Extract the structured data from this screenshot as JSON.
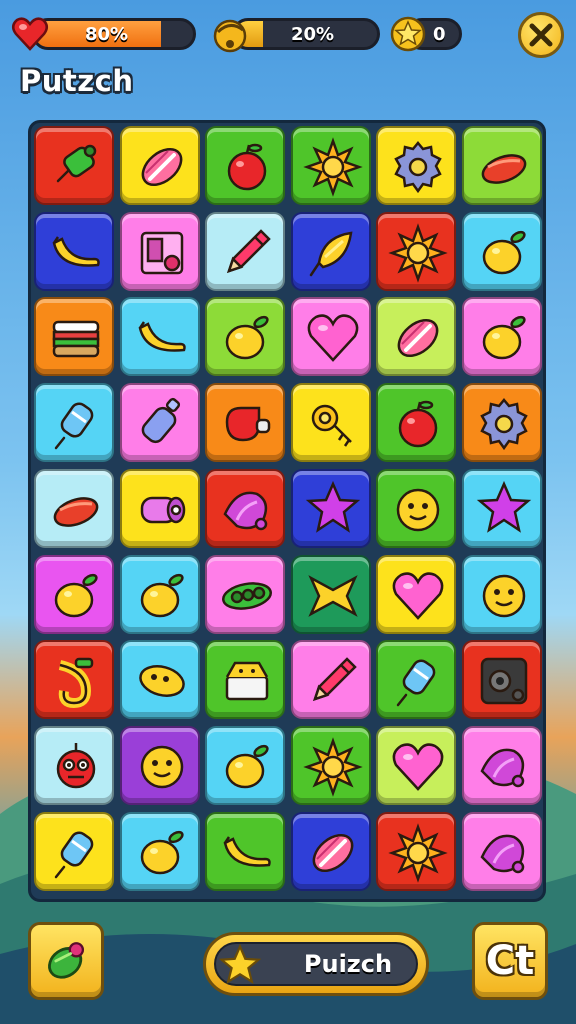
{
  "hud": {
    "health": {
      "label": "80%",
      "value": 0.8,
      "icon": "heart-icon"
    },
    "energy": {
      "label": "20%",
      "value": 0.2,
      "icon": "bomb-icon"
    },
    "coins": {
      "label": "0",
      "icon": "star-coin-icon"
    },
    "close": {
      "icon": "close-icon"
    }
  },
  "title": "Putzch",
  "colors": {
    "red": "#e8321f",
    "yellow": "#fde21c",
    "green": "#4fc52a",
    "darkgreen": "#1e9a5a",
    "blue": "#2f3fd8",
    "magenta": "#e955f0",
    "cyan": "#55d4f5",
    "lightblue": "#b6ecf6",
    "orange": "#f88a18",
    "pink": "#ff7ee8",
    "purple": "#9a3fd8",
    "lightgreen": "#c7ef5b",
    "lime": "#8ddb38"
  },
  "board": {
    "rows": [
      [
        {
          "color": "red",
          "icon": "green-candy-icon"
        },
        {
          "color": "yellow",
          "icon": "pink-candy-icon"
        },
        {
          "color": "green",
          "icon": "apple-icon"
        },
        {
          "color": "green",
          "icon": "sun-icon"
        },
        {
          "color": "yellow",
          "icon": "gear-icon"
        },
        {
          "color": "lime",
          "icon": "sausage-icon"
        }
      ],
      [
        {
          "color": "blue",
          "icon": "banana-icon"
        },
        {
          "color": "pink",
          "icon": "box-icon"
        },
        {
          "color": "lightblue",
          "icon": "pencil-icon"
        },
        {
          "color": "blue",
          "icon": "cone-icon"
        },
        {
          "color": "red",
          "icon": "sun-icon"
        },
        {
          "color": "cyan",
          "icon": "lemon-icon"
        }
      ],
      [
        {
          "color": "orange",
          "icon": "sandwich-icon"
        },
        {
          "color": "cyan",
          "icon": "banana-icon"
        },
        {
          "color": "lime",
          "icon": "lemon-icon"
        },
        {
          "color": "pink",
          "icon": "heart-icon"
        },
        {
          "color": "lightgreen",
          "icon": "pink-candy-icon"
        },
        {
          "color": "pink",
          "icon": "lemon-icon"
        }
      ],
      [
        {
          "color": "cyan",
          "icon": "candy-icon"
        },
        {
          "color": "pink",
          "icon": "bottle-icon"
        },
        {
          "color": "orange",
          "icon": "whistle-icon"
        },
        {
          "color": "yellow",
          "icon": "key-icon"
        },
        {
          "color": "green",
          "icon": "apple-icon"
        },
        {
          "color": "orange",
          "icon": "gear-icon"
        }
      ],
      [
        {
          "color": "lightblue",
          "icon": "sausage-icon"
        },
        {
          "color": "yellow",
          "icon": "roll-icon"
        },
        {
          "color": "red",
          "icon": "shell-icon"
        },
        {
          "color": "blue",
          "icon": "star-icon"
        },
        {
          "color": "green",
          "icon": "face-icon"
        },
        {
          "color": "cyan",
          "icon": "star-icon"
        }
      ],
      [
        {
          "color": "magenta",
          "icon": "lemon-icon"
        },
        {
          "color": "cyan",
          "icon": "lemon-icon"
        },
        {
          "color": "pink",
          "icon": "peapod-icon"
        },
        {
          "color": "darkgreen",
          "icon": "bow-icon"
        },
        {
          "color": "yellow",
          "icon": "heart-icon"
        },
        {
          "color": "cyan",
          "icon": "face-icon"
        }
      ],
      [
        {
          "color": "red",
          "icon": "saxophone-icon"
        },
        {
          "color": "cyan",
          "icon": "bean-icon"
        },
        {
          "color": "green",
          "icon": "cake-icon"
        },
        {
          "color": "pink",
          "icon": "pencil-icon"
        },
        {
          "color": "green",
          "icon": "candy-icon"
        },
        {
          "color": "red",
          "icon": "speaker-icon"
        }
      ],
      [
        {
          "color": "lightblue",
          "icon": "monster-icon"
        },
        {
          "color": "purple",
          "icon": "face-icon"
        },
        {
          "color": "cyan",
          "icon": "lemon-icon"
        },
        {
          "color": "green",
          "icon": "sun-icon"
        },
        {
          "color": "lightgreen",
          "icon": "heart-icon"
        },
        {
          "color": "pink",
          "icon": "shell-icon"
        }
      ],
      [
        {
          "color": "yellow",
          "icon": "candy-icon"
        },
        {
          "color": "cyan",
          "icon": "lemon-icon"
        },
        {
          "color": "green",
          "icon": "banana-icon"
        },
        {
          "color": "blue",
          "icon": "pink-candy-icon"
        },
        {
          "color": "red",
          "icon": "sun-icon"
        },
        {
          "color": "pink",
          "icon": "shell-icon"
        }
      ]
    ]
  },
  "bottom": {
    "left_icon": "cucumber-icon",
    "play": {
      "label": "Puizch",
      "icon": "star-icon"
    },
    "right_label": "Ct"
  }
}
